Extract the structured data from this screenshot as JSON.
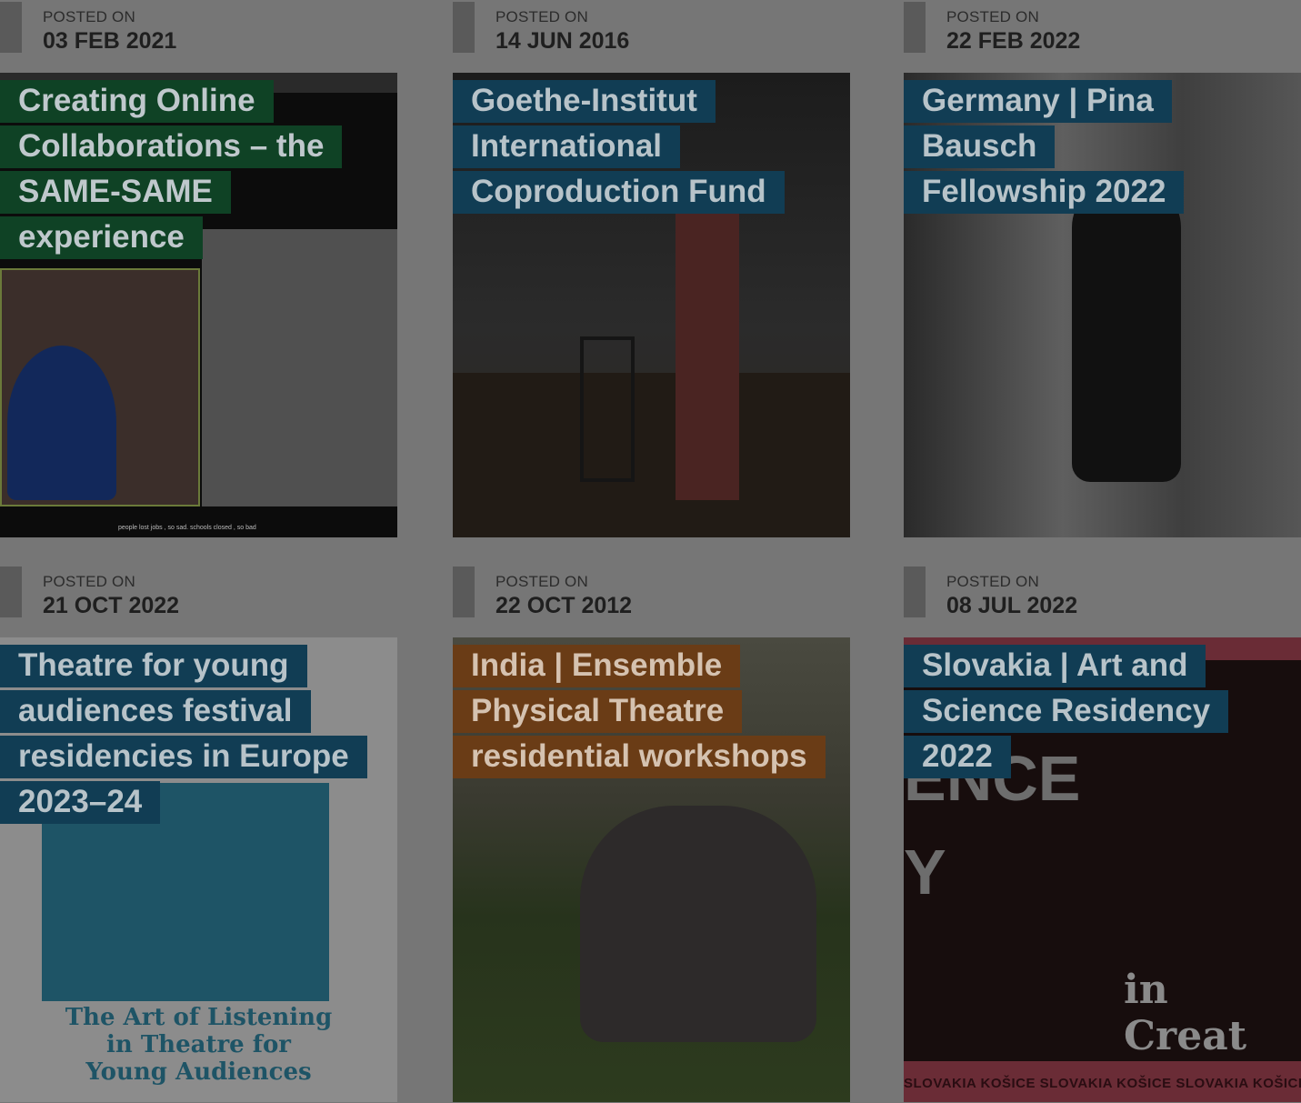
{
  "date_label": "POSTED ON",
  "posts": [
    {
      "date": "03 FEB 2021",
      "title_lines": [
        "Creating Online",
        "Collaborations – the",
        "SAME-SAME",
        "experience"
      ],
      "label_color": "#0f4225",
      "image_text": "people lost jobs , so sad. schools closed , so bad"
    },
    {
      "date": "14 JUN 2016",
      "title_lines": [
        "Goethe-Institut",
        "International",
        "Coproduction Fund"
      ],
      "label_color": "#113d54"
    },
    {
      "date": "22 FEB 2022",
      "title_lines": [
        "Germany | Pina Bausch",
        "Fellowship 2022"
      ],
      "label_color": "#113d54"
    },
    {
      "date": "21 OCT 2022",
      "title_lines": [
        "Theatre for young",
        "audiences festival",
        "residencies in Europe",
        "2023–24"
      ],
      "label_color": "#113d54",
      "image_text": [
        "The Art of Listening",
        "in Theatre for",
        "Young Audiences"
      ]
    },
    {
      "date": "22 OCT 2012",
      "title_lines": [
        "India | Ensemble",
        "Physical Theatre",
        "residential workshops"
      ],
      "label_color": "#6a3c16"
    },
    {
      "date": "08 JUL 2022",
      "title_lines": [
        "Slovakia | Art and",
        "Science Residency",
        "2022"
      ],
      "label_color": "#113d54",
      "image_text": {
        "big": "ENCE",
        "y": "Y",
        "creat": "in Creat",
        "tags": "SLOVAKIA  KOŠICE   SLOVAKIA  KOŠICE   SLOVAKIA  KOŠICE"
      }
    }
  ]
}
